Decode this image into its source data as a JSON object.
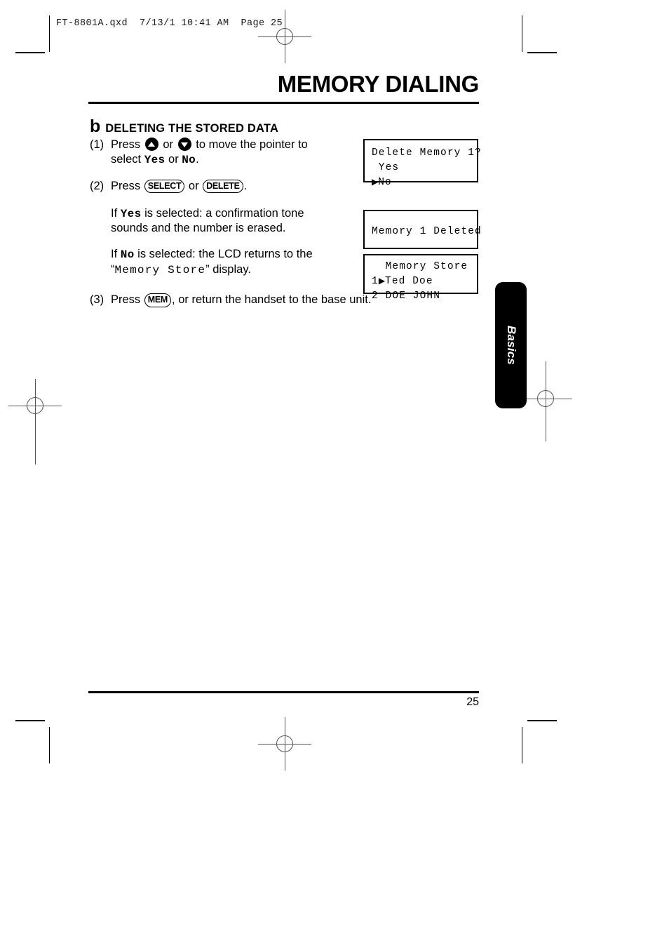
{
  "print_marks": {
    "file_header": "FT-8801A.qxd  7/13/1 10:41 AM  Page 25"
  },
  "page": {
    "title": "MEMORY DIALING",
    "section": {
      "letter": "b",
      "heading": "DELETING THE STORED DATA"
    },
    "steps": [
      {
        "number": "(1)",
        "text_before_up": "Press",
        "text_between_arrows": "or",
        "text_after_arrows": "to move the pointer to",
        "line2_before": "select",
        "line2_yes": "Yes",
        "line2_or": "or",
        "line2_no": "No",
        "line2_end": "."
      },
      {
        "number": "(2)",
        "text_before": "Press",
        "key_select": "SELECT",
        "text_or": "or",
        "key_delete": "DELETE",
        "text_end": "."
      },
      {
        "number": "(3)",
        "text_before": "Press",
        "key_mem": "MEM",
        "text_after": ", or return the handset to the base unit."
      }
    ],
    "paragraphs": [
      {
        "lead": "If",
        "keyword": "Yes",
        "line1_rest": "is selected: a confirmation tone",
        "line2": "sounds and the number is erased."
      },
      {
        "lead": "If",
        "keyword": "No",
        "line1_rest": "is selected: the LCD returns to the",
        "line2_open_quote": "“",
        "line2_display": "Memory Store",
        "line2_close": "” display."
      }
    ],
    "lcd_displays": [
      {
        "name": "delete-confirm",
        "line1": "Delete Memory 1?",
        "line2": " Yes",
        "line3_pointer": "▶",
        "line3_text": "No"
      },
      {
        "name": "deleted-confirmation",
        "line1": "Memory 1 Deleted"
      },
      {
        "name": "memory-store-list",
        "line1": "  Memory Store",
        "line2_index": "1",
        "line2_pointer": "▶",
        "line2_text": "Ted Doe",
        "line3": "2 DOE JOHN"
      }
    ],
    "side_tab": {
      "label": "Basics"
    },
    "footer": {
      "page_number": "25"
    }
  }
}
